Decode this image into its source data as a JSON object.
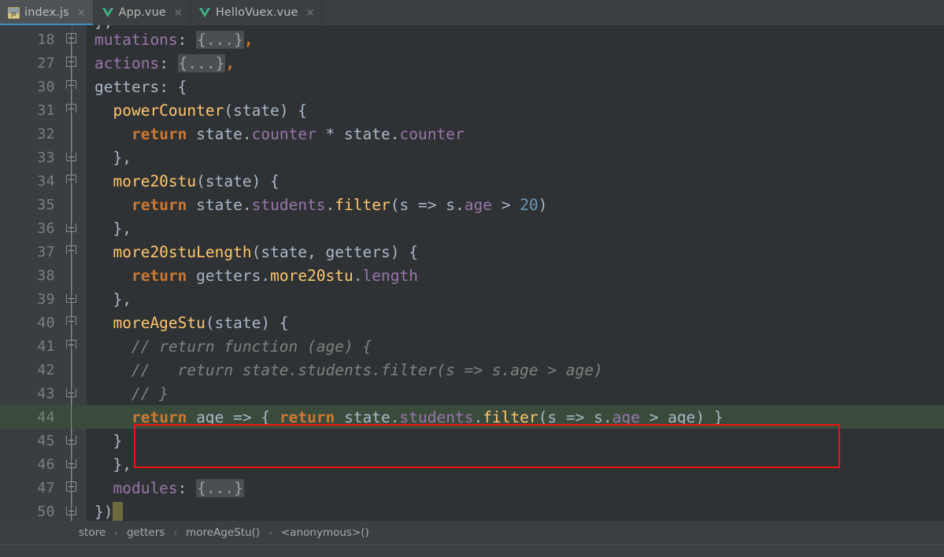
{
  "window": {
    "theme_bg": "#3c3f41",
    "editor_bg": "#2f3234",
    "gutter_bg": "#3b3e40",
    "accent": "#3d8dc4",
    "annotation_color": "#f31212"
  },
  "tabs": [
    {
      "label": "index.js",
      "icon": "js-file-icon",
      "active": true,
      "close_label": "×"
    },
    {
      "label": "App.vue",
      "icon": "vue-file-icon",
      "active": false,
      "close_label": "×"
    },
    {
      "label": "HelloVuex.vue",
      "icon": "vue-file-icon",
      "active": false,
      "close_label": "×"
    }
  ],
  "editor": {
    "lines": [
      {
        "num": "18",
        "fold": "plus",
        "text": "mutations: {...},"
      },
      {
        "num": "27",
        "fold": "plus",
        "text": "actions: {...},"
      },
      {
        "num": "30",
        "fold": "cap",
        "text": "getters: {"
      },
      {
        "num": "31",
        "fold": "cap",
        "text": "  powerCounter(state) {"
      },
      {
        "num": "32",
        "fold": "none",
        "text": "    return state.counter * state.counter"
      },
      {
        "num": "33",
        "fold": "capb",
        "text": "  },"
      },
      {
        "num": "34",
        "fold": "cap",
        "text": "  more20stu(state) {"
      },
      {
        "num": "35",
        "fold": "none",
        "text": "    return state.students.filter(s => s.age > 20)"
      },
      {
        "num": "36",
        "fold": "capb",
        "text": "  },"
      },
      {
        "num": "37",
        "fold": "cap",
        "text": "  more20stuLength(state, getters) {"
      },
      {
        "num": "38",
        "fold": "none",
        "text": "    return getters.more20stu.length"
      },
      {
        "num": "39",
        "fold": "capb",
        "text": "  },"
      },
      {
        "num": "40",
        "fold": "cap",
        "text": "  moreAgeStu(state) {"
      },
      {
        "num": "41",
        "fold": "cap",
        "text": "    // return function (age) {"
      },
      {
        "num": "42",
        "fold": "none",
        "text": "    //   return state.students.filter(s => s.age > age)"
      },
      {
        "num": "43",
        "fold": "capb",
        "text": "    // }"
      },
      {
        "num": "44",
        "fold": "none",
        "text": "    return age => { return state.students.filter(s => s.age > age) }"
      },
      {
        "num": "45",
        "fold": "capb",
        "text": "  }"
      },
      {
        "num": "46",
        "fold": "capb",
        "text": "  },"
      },
      {
        "num": "47",
        "fold": "plus",
        "text": "  modules: {...}"
      },
      {
        "num": "50",
        "fold": "capb",
        "text": "})"
      }
    ],
    "highlighted_line": "44",
    "annotation": "red-rectangle-around-line-44",
    "caret_line": "44",
    "top_partial_line": "},"
  },
  "breadcrumb": {
    "separator": "›",
    "items": [
      {
        "label": "store"
      },
      {
        "label": "getters"
      },
      {
        "label": "moreAgeStu()"
      },
      {
        "label": "<anonymous>()"
      }
    ]
  }
}
